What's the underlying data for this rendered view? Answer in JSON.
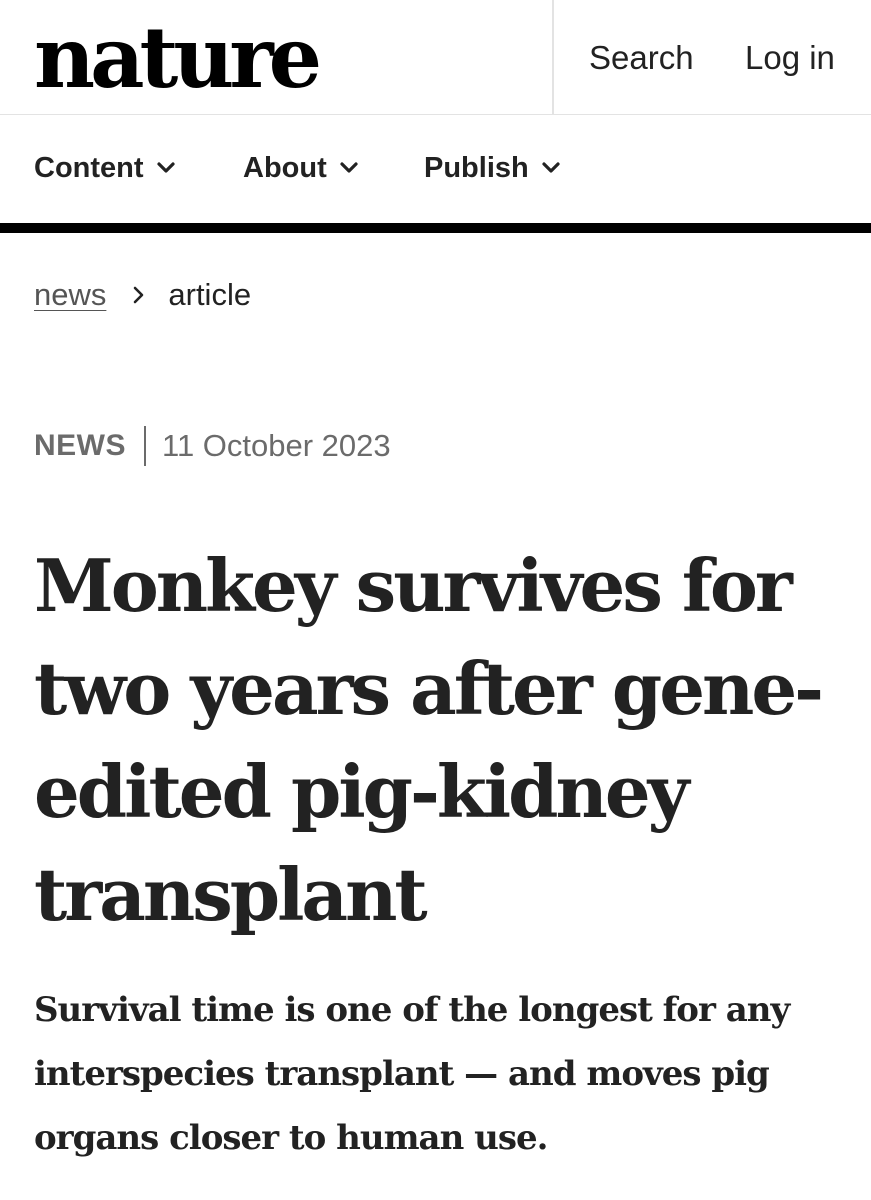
{
  "header": {
    "logo_text": "nature",
    "search_label": "Search",
    "login_label": "Log in"
  },
  "menu": {
    "items": [
      {
        "label": "Content",
        "icon": "chevron-down-icon"
      },
      {
        "label": "About",
        "icon": "chevron-down-icon"
      },
      {
        "label": "Publish",
        "icon": "chevron-down-icon"
      }
    ]
  },
  "breadcrumb": {
    "items": [
      {
        "label": "news"
      },
      {
        "label": "article"
      }
    ],
    "separator_icon": "chevron-right-icon"
  },
  "article": {
    "type": "NEWS",
    "date": "11 October 2023",
    "title": "Monkey survives for two years after gene-edited pig-kidney transplant",
    "standfirst": "Survival time is one of the longest for any interspecies transplant — and moves pig organs closer to human use."
  },
  "colors": {
    "text": "#222222",
    "muted": "#6b6b6b",
    "rule": "#000000",
    "divider": "#e3e3e3"
  }
}
